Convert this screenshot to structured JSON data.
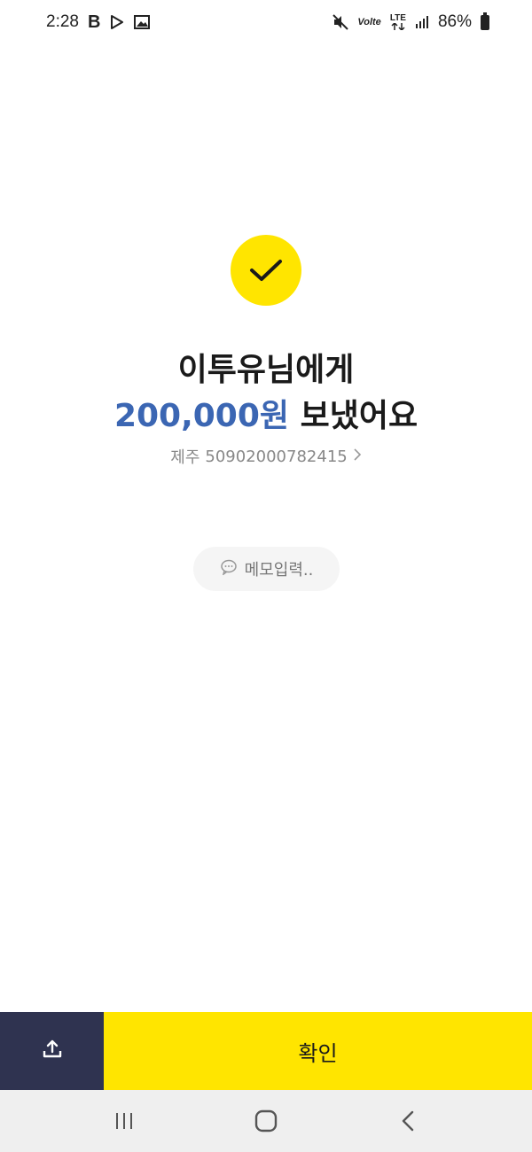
{
  "status_bar": {
    "time": "2:28",
    "app_letter": "B",
    "network_top": "LTE",
    "volte": "Volte",
    "battery": "86%"
  },
  "result": {
    "recipient_line": "이투유님에게",
    "amount": "200,000원",
    "sent_suffix": "보냈어요",
    "bank": "제주",
    "account_number": "50902000782415"
  },
  "memo": {
    "placeholder": "메모입력.."
  },
  "actions": {
    "confirm_label": "확인"
  },
  "colors": {
    "accent_yellow": "#ffe500",
    "amount_blue": "#3b66b3",
    "share_navy": "#2f3350"
  }
}
